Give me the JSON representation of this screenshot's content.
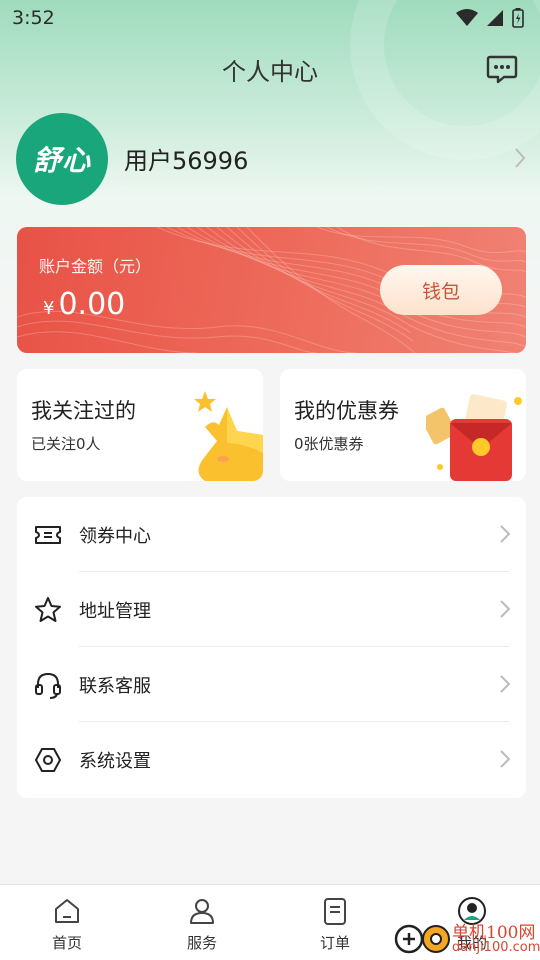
{
  "status_bar": {
    "time": "3:52"
  },
  "header": {
    "title": "个人中心"
  },
  "profile": {
    "avatar_text": "舒心",
    "username": "用户56996"
  },
  "wallet": {
    "label": "账户金额（元）",
    "currency_symbol": "¥",
    "amount": "0.00",
    "button_label": "钱包"
  },
  "cards": {
    "following": {
      "title": "我关注过的",
      "subtitle": "已关注0人"
    },
    "coupons": {
      "title": "我的优惠券",
      "subtitle": "0张优惠券"
    }
  },
  "menu": {
    "items": [
      {
        "label": "领券中心",
        "icon": "ticket-icon"
      },
      {
        "label": "地址管理",
        "icon": "star-icon"
      },
      {
        "label": "联系客服",
        "icon": "headset-icon"
      },
      {
        "label": "系统设置",
        "icon": "settings-icon"
      }
    ]
  },
  "tabbar": {
    "tabs": [
      {
        "label": "首页",
        "icon": "home-icon"
      },
      {
        "label": "服务",
        "icon": "user-icon"
      },
      {
        "label": "订单",
        "icon": "order-icon"
      },
      {
        "label": "我的",
        "icon": "profile-icon",
        "active": true
      }
    ]
  },
  "watermark": {
    "text": "单机100网",
    "sub": "danji100.com"
  },
  "colors": {
    "accent_green": "#19a67a",
    "wallet_red": "#e85246",
    "wallet_button_text": "#c9533b"
  }
}
